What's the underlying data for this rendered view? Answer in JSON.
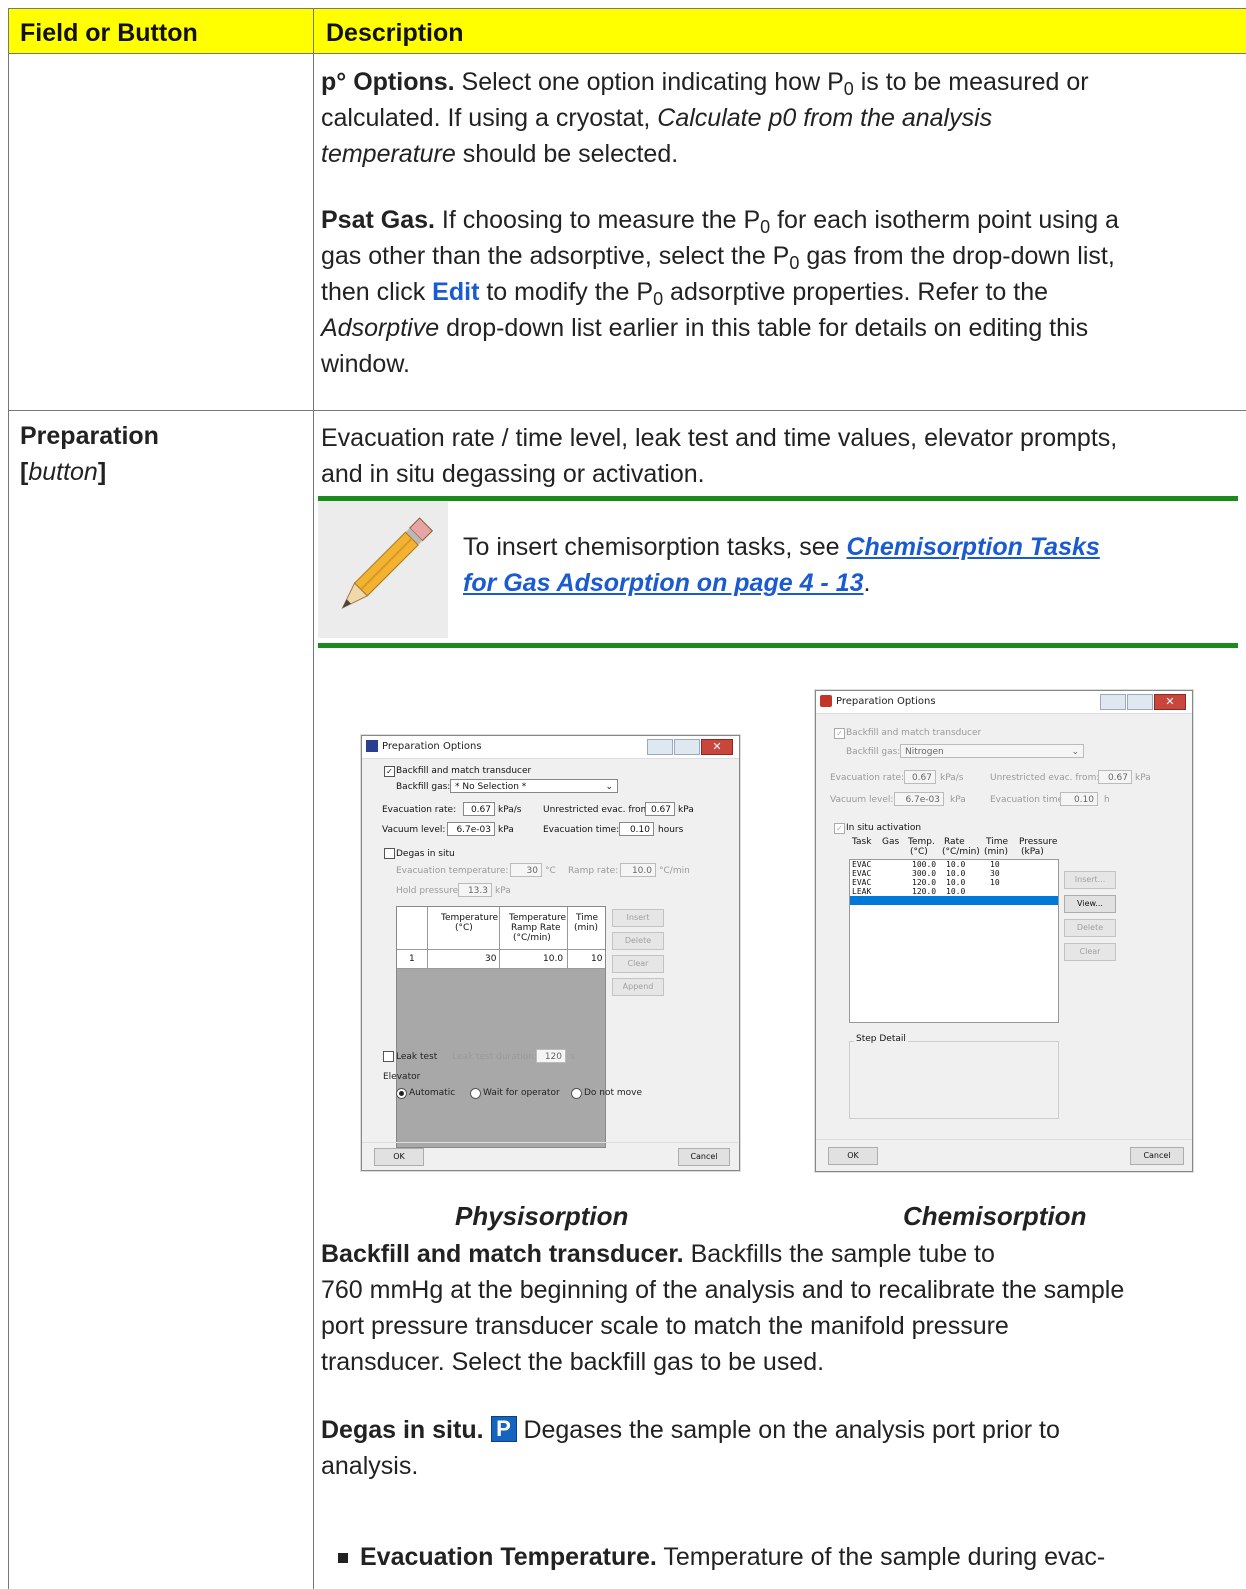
{
  "header": {
    "col1": "Field or Button",
    "col2": "Description"
  },
  "p_options": {
    "title": "p° Options.",
    "text1": " Select one option indicating how P",
    "sub0": "0",
    "text2": " is to be measured or",
    "line2a": "calculated. If using a cryostat, ",
    "line2_italic": "Calculate p0 from the analysis",
    "line3_italic": "temperature",
    "line3b": " should be selected."
  },
  "psat": {
    "title": "Psat Gas.",
    "l1a": " If choosing to measure the P",
    "l1b": " for each isotherm point using a",
    "l2a": "gas other than the adsorptive, select the P",
    "l2b": " gas from the drop-down list,",
    "l3a": "then click ",
    "l3_link": "Edit",
    "l3b": " to modify the P",
    "l3c": " adsorptive properties. Refer to the",
    "l4_italic": "Adsorptive",
    "l4b": " drop-down list earlier in this table for details on editing this",
    "l5": "window.",
    "sub0": "0"
  },
  "preparation": {
    "label": "Preparation",
    "label_bracket_open": "[",
    "label_italic": "button",
    "label_bracket_close": "]",
    "desc1": "Evacuation rate / time level, leak test and time values, elevator prompts,",
    "desc2": "and in situ degassing or activation."
  },
  "note": {
    "text": "To insert chemisorption tasks, see ",
    "link1": "Chemisorption Tasks ",
    "link2": "for Gas Adsorption  on page 4 - 13",
    "end": "."
  },
  "physi_dialog": {
    "title": "Preparation Options",
    "backfill_label": "Backfill and match transducer",
    "backfill_gas_label": "Backfill gas:",
    "backfill_gas_value": "* No Selection *",
    "evac_rate_label": "Evacuation rate:",
    "evac_rate_value": "0.67",
    "evac_rate_unit": "kPa/s",
    "unrestricted_label": "Unrestricted evac. from:",
    "unrestricted_value": "0.67",
    "unrestricted_unit": "kPa",
    "vacuum_label": "Vacuum level:",
    "vacuum_value": "6.7e-03",
    "vacuum_unit": "kPa",
    "evac_time_label": "Evacuation time:",
    "evac_time_value": "0.10",
    "evac_time_unit": "hours",
    "degas_label": "Degas in situ",
    "evac_temp_label": "Evacuation temperature:",
    "evac_temp_value": "30",
    "evac_temp_unit": "°C",
    "ramp_label": "Ramp rate:",
    "ramp_value": "10.0",
    "ramp_unit": "°C/min",
    "hold_label": "Hold pressure:",
    "hold_value": "13.3",
    "hold_unit": "kPa",
    "col_temp": "Temperature",
    "col_temp_unit": "(°C)",
    "col_ramp1": "Temperature",
    "col_ramp2": "Ramp Rate",
    "col_ramp3": "(°C/min)",
    "col_time": "Time",
    "col_time_unit": "(min)",
    "row_index": "1",
    "row_temp": "30",
    "row_ramp": "10.0",
    "row_time": "10",
    "btn_insert": "Insert",
    "btn_delete": "Delete",
    "btn_clear": "Clear",
    "btn_append": "Append",
    "leak_label": "Leak test",
    "leak_dur_label": "Leak test duration:",
    "leak_dur_value": "120",
    "leak_dur_unit": "s",
    "elevator_label": "Elevator",
    "radio_auto": "Automatic",
    "radio_wait": "Wait for operator",
    "radio_nomove": "Do not move",
    "ok": "OK",
    "cancel": "Cancel"
  },
  "chemi_dialog": {
    "title": "Preparation Options",
    "backfill_label": "Backfill and match transducer",
    "backfill_gas_label": "Backfill gas:",
    "backfill_gas_value": "Nitrogen",
    "evac_rate_label": "Evacuation rate:",
    "evac_rate_value": "0.67",
    "evac_rate_unit": "kPa/s",
    "unrestricted_label": "Unrestricted evac. from:",
    "unrestricted_value": "0.67",
    "unrestricted_unit": "kPa",
    "vacuum_label": "Vacuum level:",
    "vacuum_value": "6.7e-03",
    "vacuum_unit": "kPa",
    "evac_time_label": "Evacuation time:",
    "evac_time_value": "0.10",
    "evac_time_unit": "h",
    "activation_label": "In situ activation",
    "col_task": "Task",
    "col_gas": "Gas",
    "col_temp": "Temp.",
    "col_temp_unit": "(°C)",
    "col_rate": "Rate",
    "col_rate_unit": "(°C/min)",
    "col_time": "Time",
    "col_time_unit": "(min)",
    "col_pressure": "Pressure",
    "col_pressure_unit": "(kPa)",
    "rows": [
      {
        "task": "EVAC",
        "temp": "100.0",
        "rate": "10.0",
        "time": "10"
      },
      {
        "task": "EVAC",
        "temp": "300.0",
        "rate": "10.0",
        "time": "30"
      },
      {
        "task": "EVAC",
        "temp": "120.0",
        "rate": "10.0",
        "time": "10"
      },
      {
        "task": "LEAK",
        "temp": "120.0",
        "rate": "10.0",
        "time": ""
      }
    ],
    "btn_insert": "Insert...",
    "btn_view": "View...",
    "btn_delete": "Delete",
    "btn_clear": "Clear",
    "step_detail": "Step Detail",
    "ok": "OK",
    "cancel": "Cancel"
  },
  "captions": {
    "physi": "Physisorption",
    "chemi": "Chemisorption"
  },
  "backfill_desc": {
    "title": "Backfill and match transducer.",
    "l1": " Backfills the sample tube to",
    "l2": "760 mmHg at the beginning of the analysis and to recalibrate the sample",
    "l3": "port pressure transducer scale to match the manifold pressure",
    "l4": "transducer. Select the backfill gas to be used."
  },
  "degas_desc": {
    "title": "Degas in situ.",
    "badge": "P",
    "l1": " Degases the sample on the analysis port prior to",
    "l2": "analysis."
  },
  "evac_temp_desc": {
    "title": "Evacuation Temperature.",
    "l1": " Temperature of the sample during evac-"
  },
  "colors": {
    "header": "#ffff00",
    "note_border": "#1d8a1d",
    "link": "#1a5bd1"
  }
}
